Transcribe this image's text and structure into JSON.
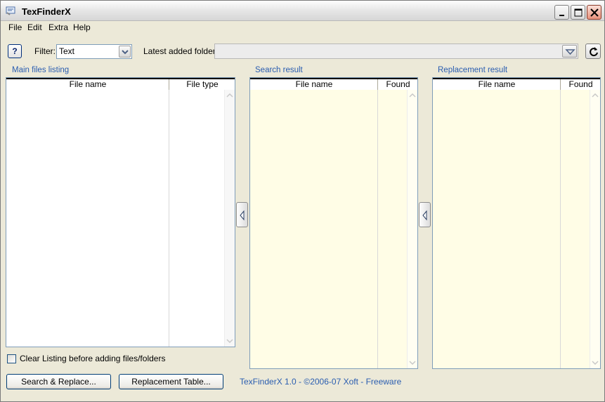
{
  "window": {
    "title": "TexFinderX"
  },
  "menu": {
    "items": [
      "File",
      "Edit",
      "Extra",
      "Help"
    ]
  },
  "toolbar": {
    "help_label": "?",
    "filter_label": "Filter:",
    "filter_value": "Text",
    "folder_label": "Latest added folder:",
    "folder_value": ""
  },
  "main_list": {
    "title": "Main files listing",
    "columns": [
      "File name",
      "File type"
    ]
  },
  "search_list": {
    "title": "Search result",
    "columns": [
      "File name",
      "Found"
    ]
  },
  "replace_list": {
    "title": "Replacement result",
    "columns": [
      "File name",
      "Found"
    ]
  },
  "options": {
    "clear_listing_label": "Clear Listing before adding files/folders",
    "clear_listing_checked": false
  },
  "buttons": {
    "search_replace": "Search & Replace...",
    "replacement_table": "Replacement Table..."
  },
  "footer": {
    "text": "TexFinderX 1.0 - ©2006-07 Xoft - Freeware"
  },
  "colors": {
    "result_bg": "#fffde6",
    "accent_text": "#2a5db0",
    "chrome": "#ece9d8"
  },
  "icons": {
    "app": "app-icon",
    "refresh": "refresh-icon",
    "combo_arrow": "chevron-down-icon",
    "move_left": "triangle-left-icon"
  }
}
